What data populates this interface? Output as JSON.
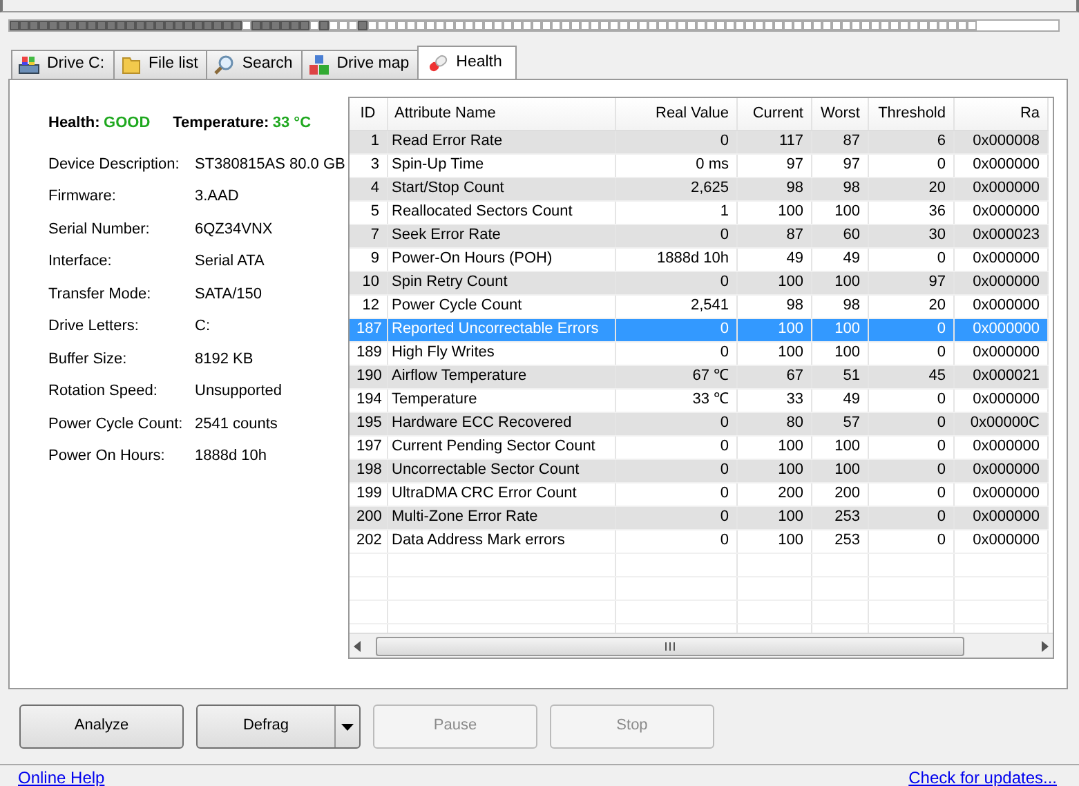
{
  "tabs": [
    {
      "label": "Drive C:",
      "selected": false
    },
    {
      "label": "File list",
      "selected": false
    },
    {
      "label": "Search",
      "selected": false
    },
    {
      "label": "Drive map",
      "selected": false
    },
    {
      "label": "Health",
      "selected": true
    }
  ],
  "summary": {
    "health_label": "Health:",
    "health_value": "GOOD",
    "temperature_label": "Temperature:",
    "temperature_value": "33 °C"
  },
  "info": [
    {
      "label": "Device Description:",
      "value": "ST380815AS 80.0 GB"
    },
    {
      "label": "Firmware:",
      "value": "3.AAD"
    },
    {
      "label": "Serial Number:",
      "value": "6QZ34VNX"
    },
    {
      "label": "Interface:",
      "value": "Serial ATA"
    },
    {
      "label": "Transfer Mode:",
      "value": "SATA/150"
    },
    {
      "label": "Drive Letters:",
      "value": "C:"
    },
    {
      "label": "Buffer Size:",
      "value": "8192 KB"
    },
    {
      "label": "Rotation Speed:",
      "value": "Unsupported"
    },
    {
      "label": "Power Cycle Count:",
      "value": "2541 counts"
    },
    {
      "label": "Power On Hours:",
      "value": "1888d 10h"
    }
  ],
  "table": {
    "columns": [
      "ID",
      "Attribute Name",
      "Real Value",
      "Current",
      "Worst",
      "Threshold",
      "Ra"
    ],
    "rows": [
      {
        "cells": [
          "1",
          "Read Error Rate",
          "0",
          "117",
          "87",
          "6",
          "0x000008"
        ],
        "selected": false
      },
      {
        "cells": [
          "3",
          "Spin-Up Time",
          "0 ms",
          "97",
          "97",
          "0",
          "0x000000"
        ],
        "selected": false
      },
      {
        "cells": [
          "4",
          "Start/Stop Count",
          "2,625",
          "98",
          "98",
          "20",
          "0x000000"
        ],
        "selected": false
      },
      {
        "cells": [
          "5",
          "Reallocated Sectors Count",
          "1",
          "100",
          "100",
          "36",
          "0x000000"
        ],
        "selected": false
      },
      {
        "cells": [
          "7",
          "Seek Error Rate",
          "0",
          "87",
          "60",
          "30",
          "0x000023"
        ],
        "selected": false
      },
      {
        "cells": [
          "9",
          "Power-On Hours (POH)",
          "1888d 10h",
          "49",
          "49",
          "0",
          "0x000000"
        ],
        "selected": false
      },
      {
        "cells": [
          "10",
          "Spin Retry Count",
          "0",
          "100",
          "100",
          "97",
          "0x000000"
        ],
        "selected": false
      },
      {
        "cells": [
          "12",
          "Power Cycle Count",
          "2,541",
          "98",
          "98",
          "20",
          "0x000000"
        ],
        "selected": false
      },
      {
        "cells": [
          "187",
          "Reported Uncorrectable Errors",
          "0",
          "100",
          "100",
          "0",
          "0x000000"
        ],
        "selected": true
      },
      {
        "cells": [
          "189",
          "High Fly Writes",
          "0",
          "100",
          "100",
          "0",
          "0x000000"
        ],
        "selected": false
      },
      {
        "cells": [
          "190",
          "Airflow Temperature",
          "67 ℃",
          "67",
          "51",
          "45",
          "0x000021"
        ],
        "selected": false
      },
      {
        "cells": [
          "194",
          "Temperature",
          "33 ℃",
          "33",
          "49",
          "0",
          "0x000000"
        ],
        "selected": false
      },
      {
        "cells": [
          "195",
          "Hardware ECC Recovered",
          "0",
          "80",
          "57",
          "0",
          "0x00000C"
        ],
        "selected": false
      },
      {
        "cells": [
          "197",
          "Current Pending Sector Count",
          "0",
          "100",
          "100",
          "0",
          "0x000000"
        ],
        "selected": false
      },
      {
        "cells": [
          "198",
          "Uncorrectable Sector Count",
          "0",
          "100",
          "100",
          "0",
          "0x000000"
        ],
        "selected": false
      },
      {
        "cells": [
          "199",
          "UltraDMA CRC Error Count",
          "0",
          "200",
          "200",
          "0",
          "0x000000"
        ],
        "selected": false
      },
      {
        "cells": [
          "200",
          "Multi-Zone Error Rate",
          "0",
          "100",
          "253",
          "0",
          "0x000000"
        ],
        "selected": false
      },
      {
        "cells": [
          "202",
          "Data Address Mark errors",
          "0",
          "100",
          "253",
          "0",
          "0x000000"
        ],
        "selected": false
      }
    ]
  },
  "buttons": [
    {
      "label": "Analyze",
      "disabled": false,
      "dropdown": false
    },
    {
      "label": "Defrag",
      "disabled": false,
      "dropdown": true
    },
    {
      "label": "Pause",
      "disabled": true,
      "dropdown": false
    },
    {
      "label": "Stop",
      "disabled": true,
      "dropdown": false
    }
  ],
  "footer": {
    "help_link": "Online Help",
    "update_link": "Check for updates..."
  }
}
